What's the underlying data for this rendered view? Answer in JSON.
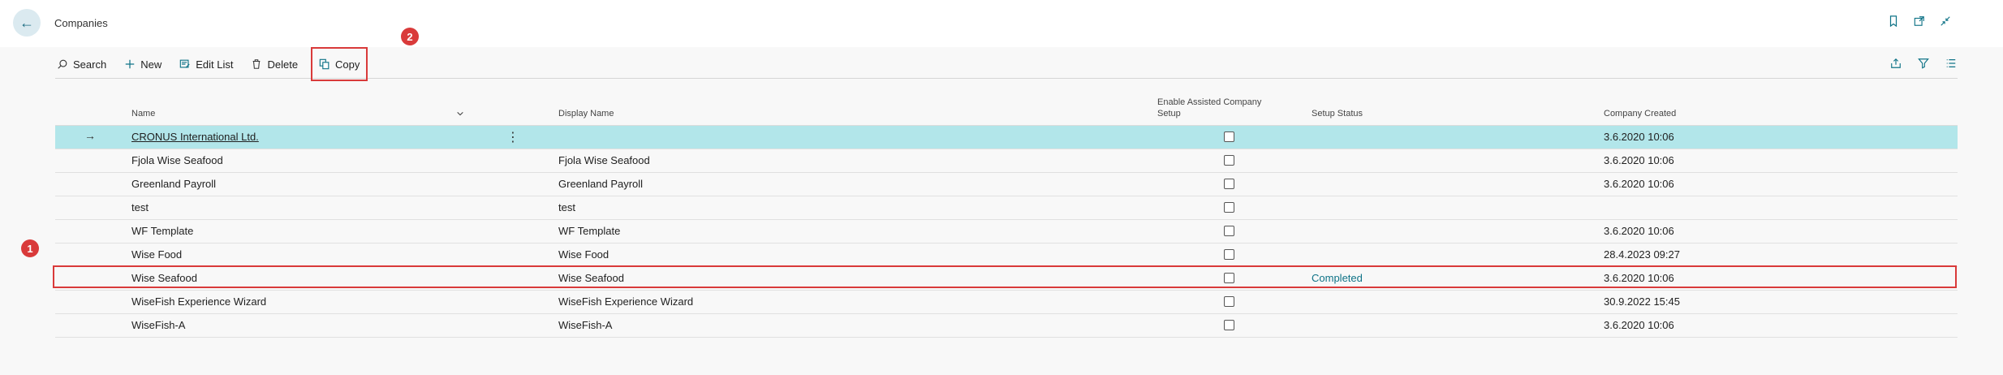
{
  "header": {
    "title": "Companies"
  },
  "toolbar": {
    "search_label": "Search",
    "new_label": "New",
    "edit_list_label": "Edit List",
    "delete_label": "Delete",
    "copy_label": "Copy"
  },
  "callouts": {
    "one": "1",
    "two": "2"
  },
  "columns": {
    "name": "Name",
    "display_name": "Display Name",
    "enable_assisted_line1": "Enable Assisted Company",
    "enable_assisted_line2": "Setup",
    "setup_status": "Setup Status",
    "company_created": "Company Created"
  },
  "rows": [
    {
      "name": "CRONUS International Ltd.",
      "display_name": "",
      "setup_status": "",
      "created": "3.6.2020 10:06",
      "enable_assisted": false
    },
    {
      "name": "Fjola Wise Seafood",
      "display_name": "Fjola Wise Seafood",
      "setup_status": "",
      "created": "3.6.2020 10:06",
      "enable_assisted": false
    },
    {
      "name": "Greenland Payroll",
      "display_name": "Greenland Payroll",
      "setup_status": "",
      "created": "3.6.2020 10:06",
      "enable_assisted": false
    },
    {
      "name": "test",
      "display_name": "test",
      "setup_status": "",
      "created": "",
      "enable_assisted": false
    },
    {
      "name": "WF Template",
      "display_name": "WF Template",
      "setup_status": "",
      "created": "3.6.2020 10:06",
      "enable_assisted": false
    },
    {
      "name": "Wise Food",
      "display_name": "Wise Food",
      "setup_status": "",
      "created": "28.4.2023 09:27",
      "enable_assisted": false
    },
    {
      "name": "Wise Seafood",
      "display_name": "Wise Seafood",
      "setup_status": "Completed",
      "created": "3.6.2020 10:06",
      "enable_assisted": false
    },
    {
      "name": "WiseFish Experience Wizard",
      "display_name": "WiseFish Experience Wizard",
      "setup_status": "",
      "created": "30.9.2022 15:45",
      "enable_assisted": false
    },
    {
      "name": "WiseFish-A",
      "display_name": "WiseFish-A",
      "setup_status": "",
      "created": "3.6.2020 10:06",
      "enable_assisted": false
    }
  ],
  "colors": {
    "accent": "#0f7387",
    "selected_row": "#b2e6ea",
    "highlight": "#d93a3a"
  },
  "icons": {
    "back": "arrow-left-icon",
    "bookmark": "bookmark-icon",
    "open_new": "open-in-new-window-icon",
    "collapse": "collapse-icon",
    "search": "search-icon",
    "new": "plus-icon",
    "edit_list": "edit-list-icon",
    "delete": "trash-icon",
    "copy": "copy-icon",
    "share": "share-icon",
    "filter": "filter-icon",
    "list": "list-view-icon",
    "row_arrow": "arrow-right-icon",
    "more": "more-vertical-icon",
    "sort": "chevron-down-icon"
  }
}
